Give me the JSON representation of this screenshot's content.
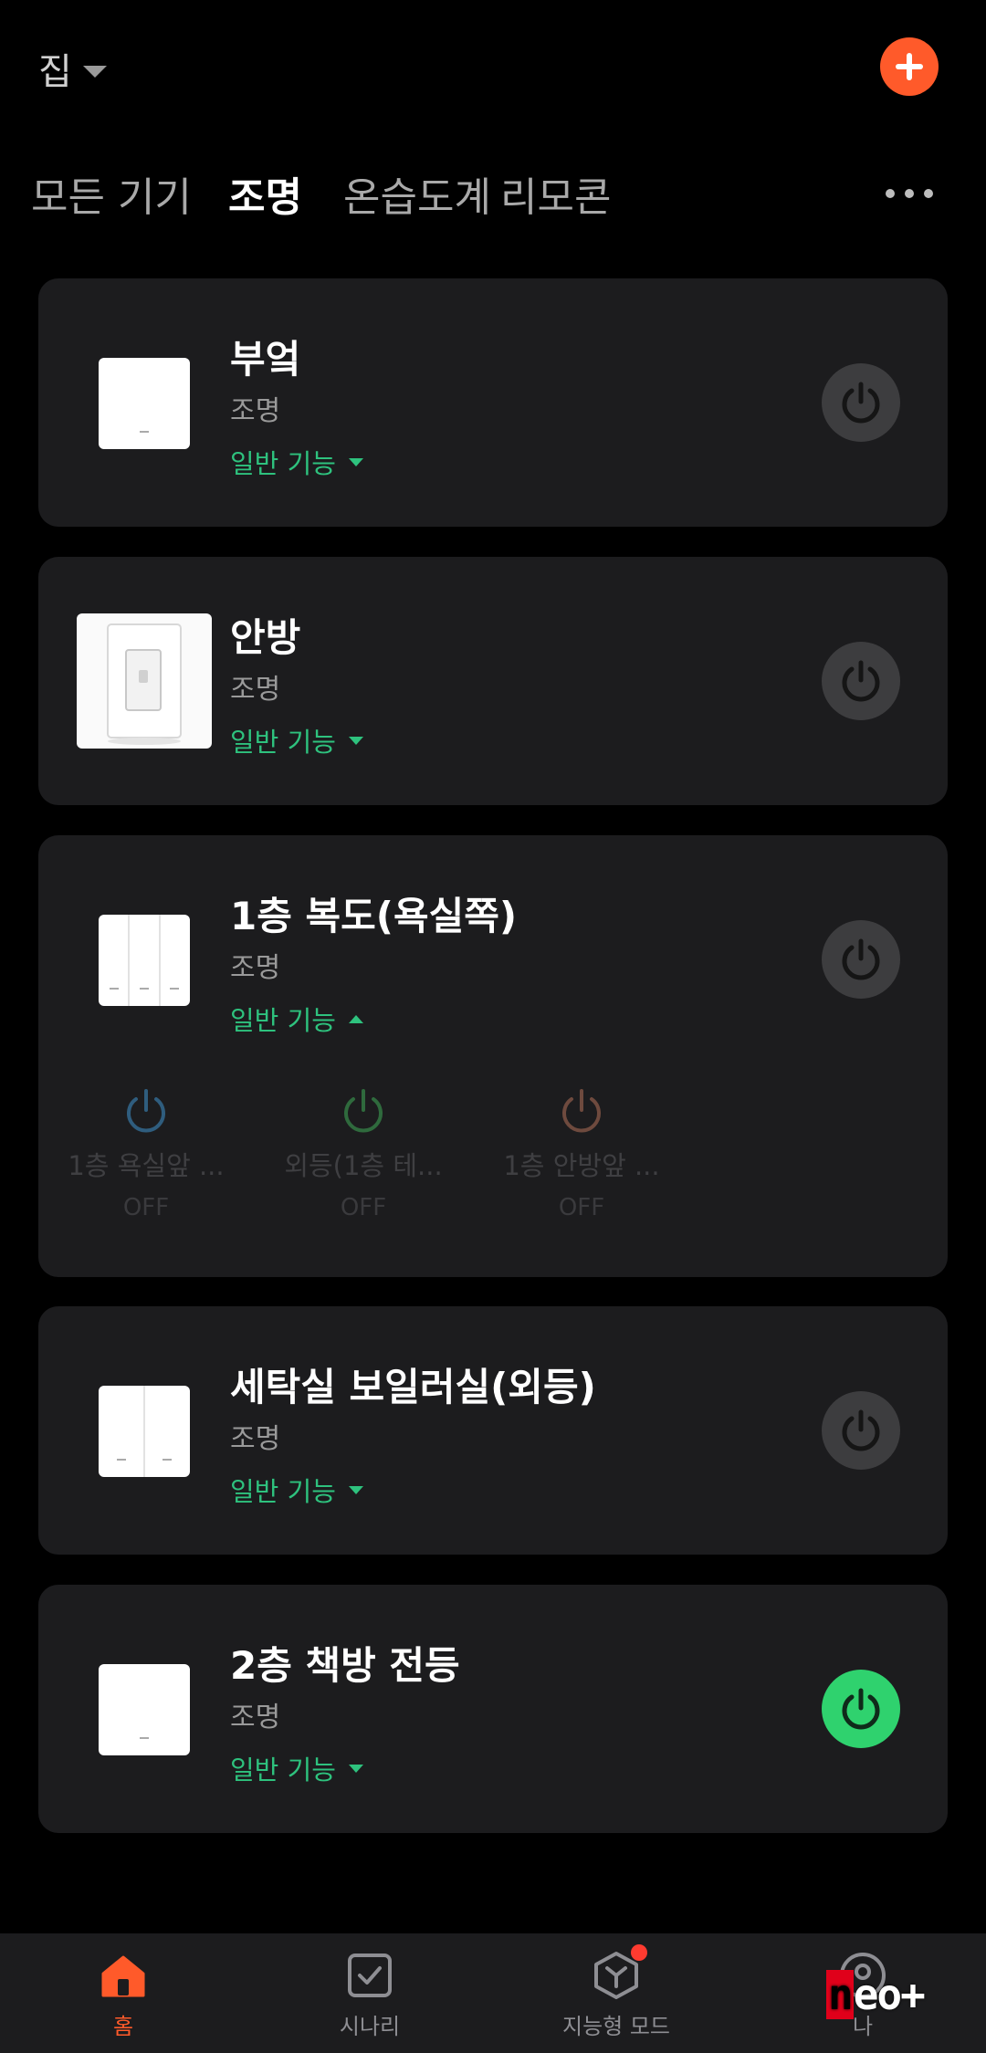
{
  "header": {
    "home_name": "집"
  },
  "tabs": [
    {
      "label": "모든 기기",
      "active": false
    },
    {
      "label": "조명",
      "active": true
    },
    {
      "label": "온습도계",
      "active": false
    },
    {
      "label": "리모콘",
      "active": false
    }
  ],
  "devices": [
    {
      "name": "부엌",
      "category": "조명",
      "function_label": "일반 기능",
      "expanded": false,
      "power": "off"
    },
    {
      "name": "안방",
      "category": "조명",
      "function_label": "일반 기능",
      "expanded": false,
      "power": "off"
    },
    {
      "name": "1층 복도(욕실쪽)",
      "category": "조명",
      "function_label": "일반 기능",
      "expanded": true,
      "power": "off",
      "switches": [
        {
          "name": "1층 욕실앞 ...",
          "state": "OFF",
          "color": "#2f5d7e"
        },
        {
          "name": "외등(1층 테...",
          "state": "OFF",
          "color": "#2f6a3d"
        },
        {
          "name": "1층 안방앞 ...",
          "state": "OFF",
          "color": "#6e4a3e"
        }
      ]
    },
    {
      "name": "세탁실 보일러실(외등)",
      "category": "조명",
      "function_label": "일반 기능",
      "expanded": false,
      "power": "off"
    },
    {
      "name": "2층 책방 전등",
      "category": "조명",
      "function_label": "일반 기능",
      "expanded": false,
      "power": "on"
    }
  ],
  "bottom_nav": [
    {
      "label": "홈",
      "icon": "home-icon",
      "active": true
    },
    {
      "label": "시나리",
      "icon": "scene-check-icon",
      "active": false
    },
    {
      "label": "지능형 모드",
      "icon": "smart-cube-icon",
      "active": false,
      "badge": true
    },
    {
      "label": "나",
      "icon": "profile-icon",
      "active": false
    }
  ],
  "colors": {
    "accent": "#ff5a2a",
    "green": "#2ec27e",
    "power_on": "#2fd26e",
    "card": "#1c1c1e"
  },
  "watermark": {
    "n": "n",
    "rest": "eo+"
  }
}
